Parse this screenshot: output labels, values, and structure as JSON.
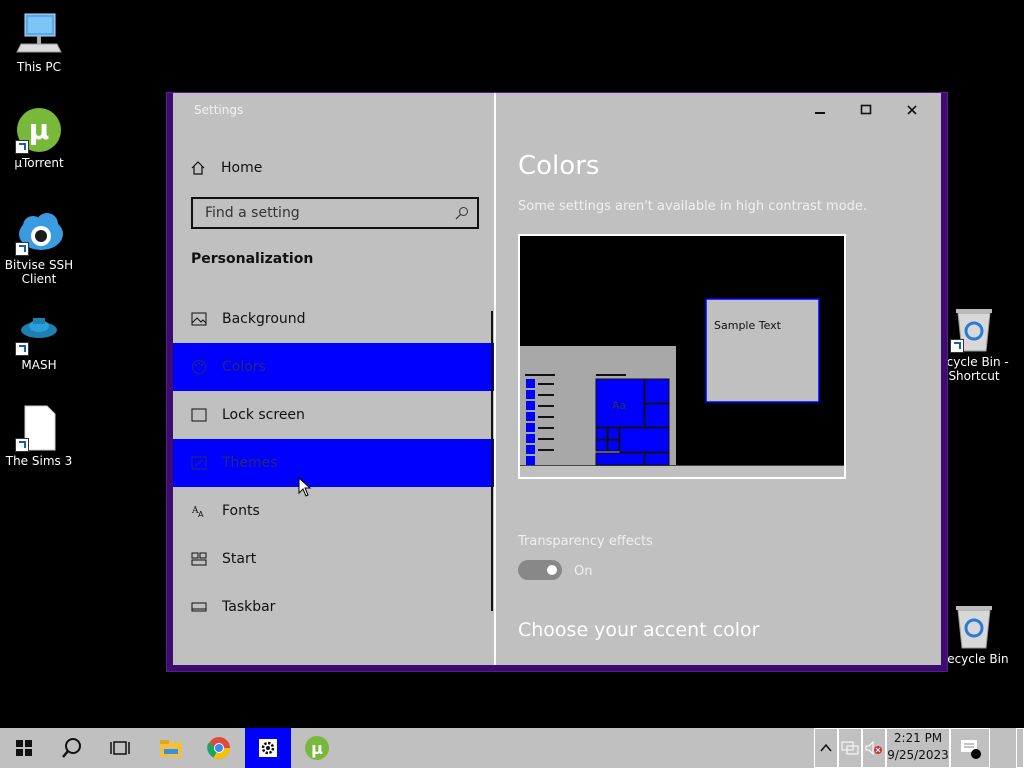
{
  "desktop": {
    "icons": [
      {
        "label": "This PC",
        "icon": "computer-icon"
      },
      {
        "label": "µTorrent",
        "icon": "utorrent-icon"
      },
      {
        "label": "Bitvise SSH Client",
        "icon": "bitvise-icon"
      },
      {
        "label": "MASH",
        "icon": "mash-icon"
      },
      {
        "label": "The Sims 3",
        "icon": "file-icon"
      },
      {
        "label": "ecycle Bin - Shortcut",
        "icon": "recycle-bin-icon"
      },
      {
        "label": "Recycle Bin",
        "icon": "recycle-bin-icon"
      }
    ]
  },
  "window": {
    "title": "Settings",
    "controls": {
      "minimize": "minimize-icon",
      "maximize": "maximize-icon",
      "close": "close-icon"
    }
  },
  "nav": {
    "home_label": "Home",
    "search_placeholder": "Find a setting",
    "section_title": "Personalization",
    "items": [
      {
        "label": "Background",
        "icon": "picture-icon",
        "selected": false
      },
      {
        "label": "Colors",
        "icon": "palette-icon",
        "selected": true
      },
      {
        "label": "Lock screen",
        "icon": "lock-screen-icon",
        "selected": false
      },
      {
        "label": "Themes",
        "icon": "themes-icon",
        "selected": true
      },
      {
        "label": "Fonts",
        "icon": "fonts-icon",
        "selected": false
      },
      {
        "label": "Start",
        "icon": "start-icon",
        "selected": false
      },
      {
        "label": "Taskbar",
        "icon": "taskbar-icon",
        "selected": false
      }
    ]
  },
  "content": {
    "heading": "Colors",
    "notice": "Some settings aren't available in high contrast mode.",
    "preview": {
      "sample_text": "Sample Text",
      "tile_text": "Aa"
    },
    "transparency_label": "Transparency effects",
    "transparency_state": "On",
    "accent_heading": "Choose your accent color"
  },
  "taskbar": {
    "time": "2:21 PM",
    "date": "9/25/2023",
    "apps": [
      "start-icon",
      "search-icon",
      "task-view-icon",
      "file-explorer-icon",
      "chrome-icon",
      "settings-icon",
      "utorrent-icon"
    ]
  },
  "colors": {
    "highlight": "#0000ff",
    "window_bg": "#c0c0c0",
    "frame": "#3c0d6e",
    "desktop": "#000000"
  }
}
